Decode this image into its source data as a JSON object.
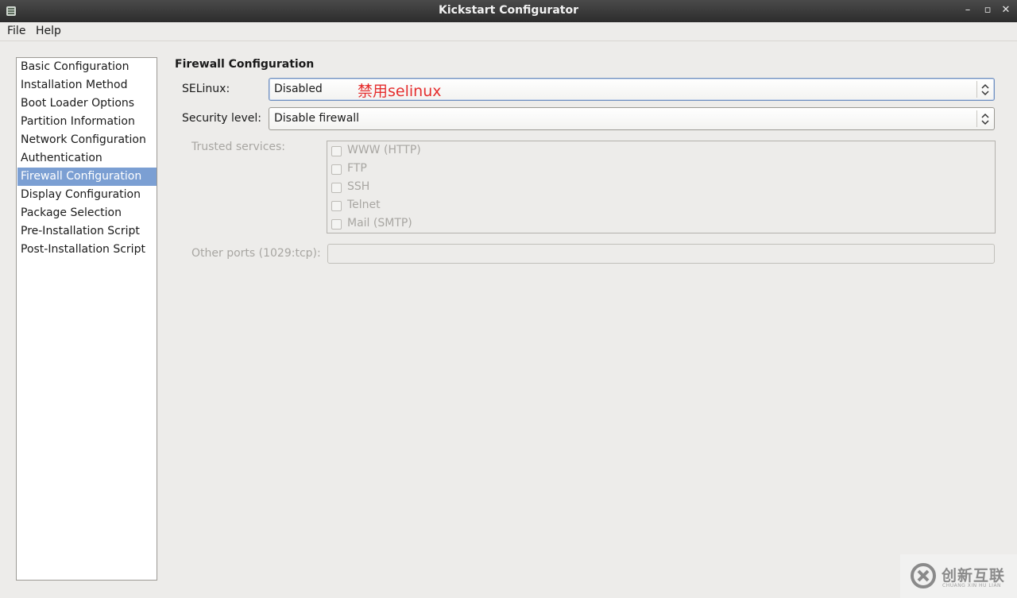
{
  "window": {
    "title": "Kickstart Configurator",
    "controls": {
      "minimize": "–",
      "maximize": "▫",
      "close": "✕"
    }
  },
  "menubar": {
    "items": [
      "File",
      "Help"
    ]
  },
  "sidebar": {
    "items": [
      "Basic Configuration",
      "Installation Method",
      "Boot Loader Options",
      "Partition Information",
      "Network Configuration",
      "Authentication",
      "Firewall Configuration",
      "Display Configuration",
      "Package Selection",
      "Pre-Installation Script",
      "Post-Installation Script"
    ],
    "selected": "Firewall Configuration"
  },
  "main": {
    "section_title": "Firewall Configuration",
    "selinux": {
      "label": "SELinux:",
      "value": "Disabled"
    },
    "annotation": "禁用selinux",
    "security_level": {
      "label": "Security level:",
      "value": "Disable firewall"
    },
    "trusted_services": {
      "label": "Trusted services:",
      "items": [
        {
          "label": "WWW (HTTP)",
          "checked": false
        },
        {
          "label": "FTP",
          "checked": false
        },
        {
          "label": "SSH",
          "checked": false
        },
        {
          "label": "Telnet",
          "checked": false
        },
        {
          "label": "Mail (SMTP)",
          "checked": false
        }
      ]
    },
    "other_ports": {
      "label": "Other ports (1029:tcp):",
      "value": ""
    }
  },
  "watermark": {
    "text": "创新互联",
    "subtext": "CHUANG XIN HU LIAN"
  },
  "colors": {
    "selection": "#7b9fd3",
    "annotation": "#e52e2e",
    "titlebar": "#2c2c2c",
    "disabled_text": "#a8a6a2"
  }
}
